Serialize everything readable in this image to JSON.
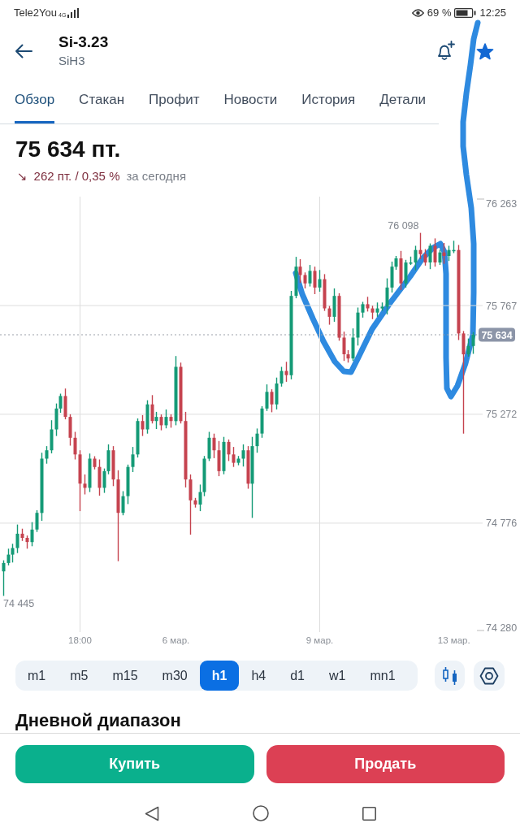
{
  "status_bar": {
    "carrier": "Tele2You",
    "network_type": "4G",
    "battery": "69 %",
    "time": "12:25"
  },
  "header": {
    "title": "Si-3.23",
    "subtitle": "SiH3",
    "favorite": true
  },
  "tabs": [
    {
      "label": "Обзор",
      "selected": true
    },
    {
      "label": "Стакан",
      "selected": false
    },
    {
      "label": "Профит",
      "selected": false
    },
    {
      "label": "Новости",
      "selected": false
    },
    {
      "label": "История",
      "selected": false
    },
    {
      "label": "Детали",
      "selected": false
    }
  ],
  "quote": {
    "price": "75 634 пт.",
    "arrow": "↘",
    "falling": true,
    "change": "262 пт. / 0,35 %",
    "period": "за сегодня"
  },
  "chart": {
    "high_label": "76 098",
    "low_label": "74 445",
    "last_price": "75 634",
    "chart_data": {
      "type": "candlestick",
      "categories": [
        null,
        null,
        null,
        null,
        null,
        null,
        null,
        null,
        null,
        null,
        null,
        null,
        null,
        null,
        null,
        null,
        "18:00",
        null,
        null,
        null,
        null,
        null,
        null,
        null,
        null,
        null,
        null,
        null,
        null,
        null,
        null,
        null,
        null,
        null,
        null,
        null,
        "6 мар.",
        null,
        null,
        null,
        null,
        null,
        null,
        null,
        null,
        null,
        null,
        null,
        null,
        null,
        null,
        null,
        null,
        null,
        null,
        null,
        null,
        null,
        null,
        null,
        null,
        null,
        null,
        null,
        null,
        null,
        "9 мар.",
        null,
        null,
        null,
        null,
        null,
        null,
        null,
        null,
        null,
        null,
        null,
        null,
        null,
        null,
        null,
        null,
        null,
        null,
        null,
        null,
        null,
        null,
        null,
        null,
        null,
        null,
        null,
        "13 мар.",
        null,
        null,
        null,
        null
      ],
      "ohlc": [
        [
          74557,
          74607,
          74445,
          74595
        ],
        [
          74595,
          74660,
          74584,
          74633
        ],
        [
          74633,
          74682,
          74597,
          74663
        ],
        [
          74663,
          74770,
          74640,
          74728
        ],
        [
          74728,
          74751,
          74695,
          74709
        ],
        [
          74709,
          74720,
          74660,
          74690
        ],
        [
          74690,
          74781,
          74671,
          74747
        ],
        [
          74747,
          74835,
          74736,
          74823
        ],
        [
          74823,
          75097,
          74787,
          75070
        ],
        [
          75070,
          75127,
          75047,
          75108
        ],
        [
          75108,
          75245,
          75094,
          75203
        ],
        [
          75203,
          75321,
          75173,
          75298
        ],
        [
          75298,
          75366,
          75279,
          75355
        ],
        [
          75355,
          75389,
          75249,
          75260
        ],
        [
          75260,
          75272,
          75129,
          75165
        ],
        [
          75165,
          75192,
          75066,
          75089
        ],
        [
          75089,
          75108,
          74831,
          74956
        ],
        [
          74956,
          74998,
          74907,
          74937
        ],
        [
          74937,
          75093,
          74918,
          75070
        ],
        [
          75070,
          75081,
          75021,
          75032
        ],
        [
          75032,
          75066,
          74901,
          74937
        ],
        [
          74937,
          75025,
          74914,
          75013
        ],
        [
          75013,
          75135,
          74999,
          75108
        ],
        [
          75108,
          75127,
          74945,
          74975
        ],
        [
          74975,
          75017,
          74603,
          74823
        ],
        [
          74823,
          74922,
          74812,
          74899
        ],
        [
          74899,
          75043,
          74863,
          75032
        ],
        [
          75032,
          75123,
          75009,
          75089
        ],
        [
          75089,
          75253,
          75075,
          75241
        ],
        [
          75241,
          75268,
          75173,
          75203
        ],
        [
          75203,
          75336,
          75184,
          75317
        ],
        [
          75317,
          75359,
          75230,
          75241
        ],
        [
          75241,
          75283,
          75205,
          75260
        ],
        [
          75260,
          75271,
          75199,
          75222
        ],
        [
          75222,
          75294,
          75208,
          75260
        ],
        [
          75260,
          75272,
          75211,
          75241
        ],
        [
          75241,
          75537,
          75222,
          75488
        ],
        [
          75488,
          75507,
          75230,
          75241
        ],
        [
          75241,
          75283,
          74939,
          74975
        ],
        [
          74975,
          74998,
          74724,
          74880
        ],
        [
          74880,
          74891,
          74847,
          74861
        ],
        [
          74861,
          74952,
          74831,
          74918
        ],
        [
          74918,
          75082,
          74899,
          75070
        ],
        [
          75070,
          75192,
          75059,
          75165
        ],
        [
          75165,
          75184,
          75072,
          75108
        ],
        [
          75108,
          75150,
          74990,
          75013
        ],
        [
          75013,
          75169,
          74999,
          75146
        ],
        [
          75146,
          75157,
          75059,
          75089
        ],
        [
          75089,
          75123,
          75032,
          75051
        ],
        [
          75051,
          75082,
          75040,
          75070
        ],
        [
          75070,
          75135,
          75034,
          75108
        ],
        [
          75108,
          75127,
          74933,
          74956
        ],
        [
          74956,
          75169,
          74800,
          75127
        ],
        [
          75127,
          75207,
          75097,
          75184
        ],
        [
          75184,
          75309,
          75165,
          75298
        ],
        [
          75298,
          75408,
          75287,
          75374
        ],
        [
          75374,
          75386,
          75281,
          75317
        ],
        [
          75317,
          75439,
          75294,
          75412
        ],
        [
          75412,
          75488,
          75398,
          75469
        ],
        [
          75469,
          75511,
          75420,
          75450
        ],
        [
          75450,
          75834,
          75431,
          75811
        ],
        [
          75811,
          75989,
          75800,
          75944
        ],
        [
          75944,
          75978,
          75870,
          75906
        ],
        [
          75906,
          75918,
          75845,
          75868
        ],
        [
          75868,
          75952,
          75854,
          75925
        ],
        [
          75925,
          75944,
          75819,
          75849
        ],
        [
          75849,
          75929,
          75830,
          75887
        ],
        [
          75887,
          75910,
          75743,
          75754
        ],
        [
          75754,
          75765,
          75680,
          75716
        ],
        [
          75716,
          75845,
          75693,
          75811
        ],
        [
          75811,
          75823,
          75607,
          75621
        ],
        [
          75621,
          75648,
          75515,
          75545
        ],
        [
          75545,
          75564,
          75507,
          75526
        ],
        [
          75526,
          75663,
          75515,
          75621
        ],
        [
          75621,
          75758,
          75585,
          75735
        ],
        [
          75735,
          75784,
          75712,
          75773
        ],
        [
          75773,
          75807,
          75740,
          75754
        ],
        [
          75754,
          75766,
          75705,
          75735
        ],
        [
          75735,
          75781,
          75716,
          75754
        ],
        [
          75754,
          75781,
          75743,
          75762
        ],
        [
          75762,
          75891,
          75726,
          75849
        ],
        [
          75849,
          75967,
          75826,
          75944
        ],
        [
          75944,
          75993,
          75930,
          75982
        ],
        [
          75982,
          76016,
          75838,
          75868
        ],
        [
          75868,
          75975,
          75849,
          75963
        ],
        [
          75963,
          75990,
          75952,
          75963
        ],
        [
          75963,
          76039,
          75927,
          76020
        ],
        [
          76020,
          76098,
          75978,
          76001
        ],
        [
          76001,
          76024,
          75949,
          75963
        ],
        [
          75963,
          76050,
          75933,
          76039
        ],
        [
          76039,
          76073,
          75944,
          75963
        ],
        [
          75963,
          76021,
          75952,
          76009
        ],
        [
          76009,
          76052,
          75957,
          75993
        ],
        [
          75993,
          76039,
          75970,
          76020
        ],
        [
          76020,
          76062,
          76006,
          76020
        ],
        [
          76020,
          76043,
          75610,
          75640
        ],
        [
          75640,
          75651,
          75184,
          75545
        ],
        [
          75545,
          75617,
          75534,
          75583
        ],
        [
          75583,
          75646,
          75547,
          75634
        ]
      ],
      "ylim": [
        74280,
        76263
      ],
      "yticks": [
        {
          "value": 76263,
          "label": "76 263"
        },
        {
          "value": 75767,
          "label": "75 767"
        },
        {
          "value": 75272,
          "label": "75 272"
        },
        {
          "value": 74776,
          "label": "74 776"
        },
        {
          "value": 74280,
          "label": "74 280"
        }
      ],
      "grid": true,
      "ref_lines": [
        {
          "axis": "y",
          "value": 75634
        }
      ]
    }
  },
  "timeframes": [
    {
      "label": "m1",
      "selected": false
    },
    {
      "label": "m5",
      "selected": false
    },
    {
      "label": "m15",
      "selected": false
    },
    {
      "label": "m30",
      "selected": false
    },
    {
      "label": "h1",
      "selected": true
    },
    {
      "label": "h4",
      "selected": false
    },
    {
      "label": "d1",
      "selected": false
    },
    {
      "label": "w1",
      "selected": false
    },
    {
      "label": "mn1",
      "selected": false
    }
  ],
  "section_title": "Дневной диапазон",
  "actions": [
    {
      "label": "Купить",
      "kind": "buy"
    },
    {
      "label": "Продать",
      "kind": "sell"
    }
  ]
}
